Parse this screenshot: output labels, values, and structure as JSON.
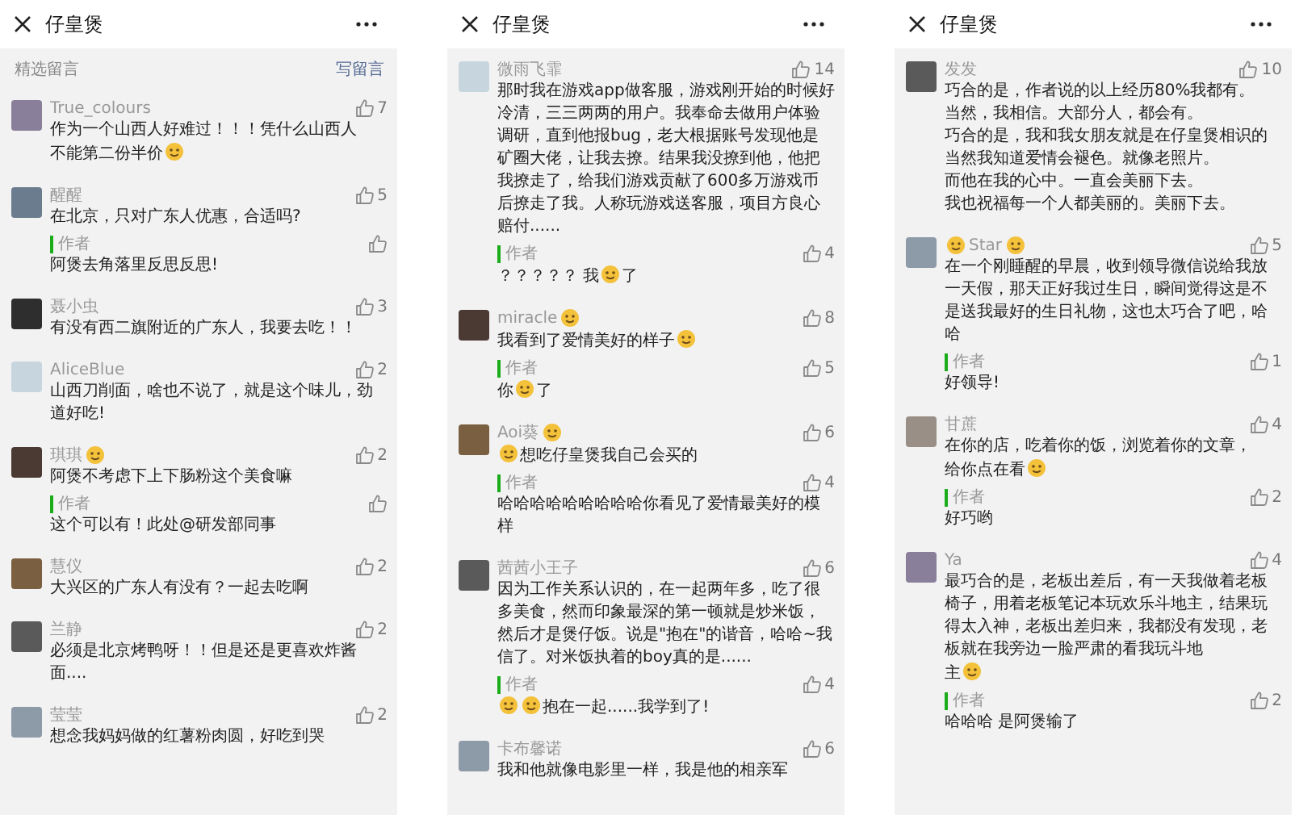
{
  "phones": [
    {
      "title": "仔皇煲",
      "section": {
        "label": "精选留言",
        "action": "写留言"
      },
      "comments": [
        {
          "name": [
            "True_colours"
          ],
          "likes": "7",
          "lines": [
            [
              "作为一个山西人好难过！！！凭什么山西人"
            ],
            [
              "不能第二份半价",
              {
                "kind": "emoji"
              }
            ]
          ]
        },
        {
          "name": [
            "醒醒"
          ],
          "likes": "5",
          "body": [
            "在北京，只对广东人优惠，合适吗?"
          ],
          "reply": {
            "label": "作者",
            "body": [
              "阿煲去角落里反思反思!"
            ]
          }
        },
        {
          "name": [
            "聂小虫"
          ],
          "likes": "3",
          "body": [
            "有没有西二旗附近的广东人，我要去吃！！"
          ]
        },
        {
          "name": [
            "AliceBlue"
          ],
          "likes": "2",
          "body": [
            "山西刀削面，啥也不说了，就是这个味儿，劲道好吃!"
          ]
        },
        {
          "name": [
            "琪琪",
            {
              "kind": "emoji"
            }
          ],
          "likes": "2",
          "body": [
            "阿煲不考虑下上下肠粉这个美食嘛"
          ],
          "reply": {
            "label": "作者",
            "body": [
              "这个可以有！此处@研发部同事"
            ]
          }
        },
        {
          "name": [
            "慧仪"
          ],
          "likes": "2",
          "body": [
            "大兴区的广东人有没有？一起去吃啊"
          ]
        },
        {
          "name": [
            "兰静"
          ],
          "likes": "2",
          "body": [
            "必须是北京烤鸭呀！！但是还是更喜欢炸酱面...."
          ]
        },
        {
          "name": [
            "莹莹"
          ],
          "likes": "2",
          "body": [
            "想念我妈妈做的红薯粉肉圆，好吃到哭"
          ]
        }
      ]
    },
    {
      "title": "仔皇煲",
      "comments": [
        {
          "name": [
            "微雨飞霏"
          ],
          "likes": "14",
          "body": [
            "那时我在游戏app做客服，游戏刚开始的时候好冷清，三三两两的用户。我奉命去做用户体验调研，直到他报bug，老大根据账号发现他是矿圈大佬，让我去撩。结果我没撩到他，他把我撩走了，给我们游戏贡献了600多万游戏币后撩走了我。人称玩游戏送客服，项目方良心赔付......"
          ],
          "reply": {
            "label": "作者",
            "likes": "4",
            "body": [
              "？？？？？ 我",
              {
                "kind": "emoji"
              },
              "了"
            ]
          }
        },
        {
          "name": [
            "miracle",
            {
              "kind": "emoji"
            }
          ],
          "likes": "8",
          "body": [
            "我看到了爱情美好的样子",
            {
              "kind": "emoji"
            }
          ],
          "reply": {
            "label": "作者",
            "likes": "5",
            "body": [
              "你",
              {
                "kind": "emoji"
              },
              "了"
            ]
          }
        },
        {
          "name": [
            "Aoi葵",
            {
              "kind": "emoji"
            }
          ],
          "likes": "6",
          "body": [
            {
              "kind": "emoji"
            },
            "想吃仔皇煲我自己会买的"
          ],
          "reply": {
            "label": "作者",
            "likes": "4",
            "body": [
              "哈哈哈哈哈哈哈哈哈你看见了爱情最美好的模样"
            ]
          }
        },
        {
          "name": [
            "茜茜小王子"
          ],
          "likes": "6",
          "body": [
            "因为工作关系认识的，在一起两年多，吃了很多美食，然而印象最深的第一顿就是炒米饭，然后才是煲仔饭。说是\"抱在\"的谐音，哈哈~我信了。对米饭执着的boy真的是......"
          ],
          "reply": {
            "label": "作者",
            "likes": "4",
            "body": [
              {
                "kind": "emoji"
              },
              {
                "kind": "emoji"
              },
              "抱在一起......我学到了!"
            ]
          }
        },
        {
          "name": [
            "卡布馨诺"
          ],
          "likes": "6",
          "body": [
            "我和他就像电影里一样，我是他的相亲军"
          ]
        }
      ]
    },
    {
      "title": "仔皇煲",
      "comments": [
        {
          "name": [
            "发发"
          ],
          "likes": "10",
          "lines": [
            [
              "巧合的是，作者说的以上经历80%我都有。"
            ],
            [
              "当然，我相信。大部分人，都会有。"
            ],
            [
              "巧合的是，我和我女朋友就是在仔皇煲相识的"
            ],
            [
              "当然我知道爱情会褪色。就像老照片。"
            ],
            [
              "而他在我的心中。一直会美丽下去。"
            ],
            [
              "我也祝福每一个人都美丽的。美丽下去。"
            ]
          ]
        },
        {
          "name": [
            {
              "kind": "emoji"
            },
            " Star ",
            {
              "kind": "emoji"
            }
          ],
          "likes": "5",
          "body": [
            "在一个刚睡醒的早晨，收到领导微信说给我放一天假，那天正好我过生日，瞬间觉得这是不是送我最好的生日礼物，这也太巧合了吧，哈哈"
          ],
          "reply": {
            "label": "作者",
            "likes": "1",
            "body": [
              "好领导!"
            ]
          }
        },
        {
          "name": [
            "甘蔗"
          ],
          "likes": "4",
          "lines": [
            [
              "在你的店，吃着你的饭，浏览着你的文章，"
            ],
            [
              "给你点在看",
              {
                "kind": "emoji"
              }
            ]
          ],
          "reply": {
            "label": "作者",
            "likes": "2",
            "body": [
              "好巧哟"
            ]
          }
        },
        {
          "name": [
            "Ya"
          ],
          "likes": "4",
          "lines": [
            [
              "最巧合的是，老板出差后，有一天我做着老板椅子，用着老板笔记本玩欢乐斗地主，结果玩得太入神，老板出差归来，我都没有发现，老板就在我旁边一脸严肃的看我玩斗地"
            ],
            [
              "主",
              {
                "kind": "emoji"
              }
            ]
          ],
          "reply": {
            "label": "作者",
            "likes": "2",
            "body": [
              "哈哈哈 是阿煲输了"
            ]
          }
        }
      ]
    }
  ]
}
